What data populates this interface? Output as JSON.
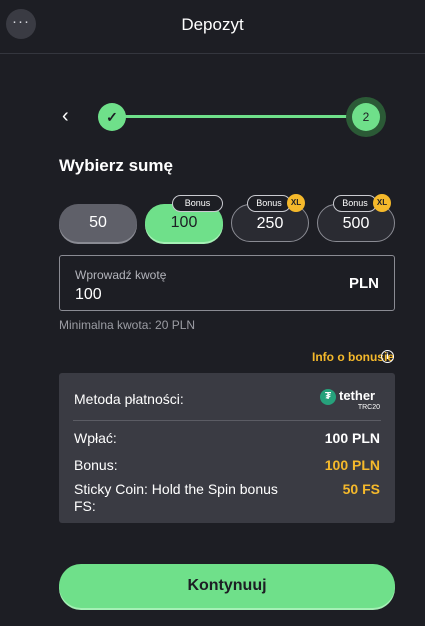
{
  "header": {
    "menu_icon": "more-icon",
    "menu_glyph": "···",
    "title": "Depozyt"
  },
  "stepper": {
    "back_glyph": "‹",
    "step1_glyph": "✓",
    "step2_label": "2"
  },
  "amount_section": {
    "title": "Wybierz sumę",
    "options": [
      {
        "value": "50",
        "bonus": null,
        "xl": false
      },
      {
        "value": "100",
        "bonus": "Bonus",
        "xl": false,
        "selected": true
      },
      {
        "value": "250",
        "bonus": "Bonus",
        "xl": true
      },
      {
        "value": "500",
        "bonus": "Bonus",
        "xl": true
      }
    ],
    "xl_label": "XL"
  },
  "amount_input": {
    "label": "Wprowadź kwotę",
    "value": "100",
    "currency": "PLN"
  },
  "hint": "Minimalna kwota: 20 PLN",
  "bonus_info_link": "Info o bonusie",
  "info_icon_glyph": "i",
  "summary": {
    "payment_method_label": "Metoda płatności:",
    "method_name": "tether",
    "method_sub": "TRC20",
    "method_icon_glyph": "₮",
    "rows": [
      {
        "label": "Wpłać:",
        "value": "100 PLN",
        "highlight": false
      },
      {
        "label": "Bonus:",
        "value": "100 PLN",
        "highlight": true
      },
      {
        "label": "Sticky Coin: Hold the Spin bonus FS:",
        "value": "50 FS",
        "highlight": true
      }
    ]
  },
  "continue_button": "Kontynuuj",
  "colors": {
    "background": "#1d1e24",
    "accent_green": "#6fe08a",
    "gold": "#f5b92b",
    "panel": "#3a3b43"
  }
}
